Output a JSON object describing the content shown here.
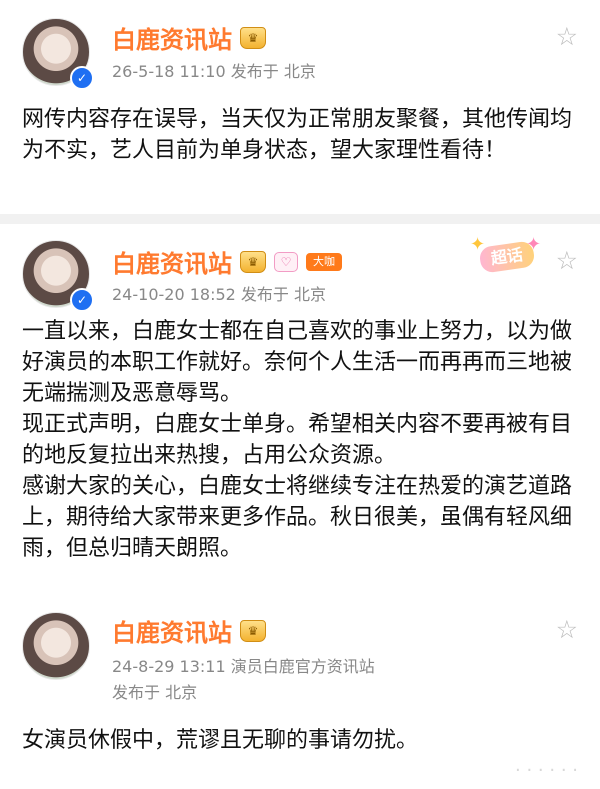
{
  "posts": [
    {
      "name": "白鹿资讯站",
      "meta": "26-5-18 11:10   发布于 北京",
      "content": "网传内容存在误导，当天仅为正常朋友聚餐，其他传闻均为不实，艺人目前为单身状态，望大家理性看待！"
    },
    {
      "name": "白鹿资讯站",
      "badge": "大咖",
      "chaohua": "超话",
      "meta": "24-10-20 18:52   发布于 北京",
      "content_lines": [
        "一直以来，白鹿女士都在自己喜欢的事业上努力，以为做好演员的本职工作就好。奈何个人生活一而再再而三地被无端揣测及恶意辱骂。",
        "现正式声明，白鹿女士单身。希望相关内容不要再被有目的地反复拉出来热搜，占用公众资源。",
        "感谢大家的关心，白鹿女士将继续专注在热爱的演艺道路上，期待给大家带来更多作品。秋日很美，虽偶有轻风细雨，但总归晴天朗照。"
      ]
    },
    {
      "name": "白鹿资讯站",
      "meta_line1": "24-8-29 13:11   演员白鹿官方资讯站",
      "meta_line2": "发布于 北京",
      "content": "女演员休假中，荒谬且无聊的事请勿扰。"
    }
  ],
  "icons": {
    "verify": "✓",
    "crown": "♛",
    "star": "☆",
    "spark": "✦"
  }
}
